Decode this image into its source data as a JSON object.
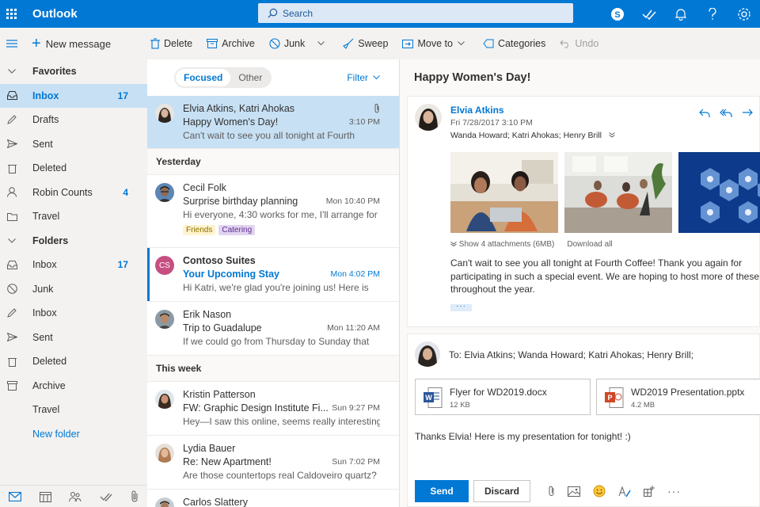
{
  "app": {
    "title": "Outlook"
  },
  "search": {
    "placeholder": "Search"
  },
  "toolbar": {
    "new_message": "New message",
    "delete": "Delete",
    "archive": "Archive",
    "junk": "Junk",
    "sweep": "Sweep",
    "move_to": "Move to",
    "categories": "Categories",
    "undo": "Undo"
  },
  "sidebar": {
    "favorites": "Favorites",
    "folders": "Folders",
    "new_folder": "New folder",
    "favorites_items": [
      {
        "label": "Inbox",
        "count": "17",
        "icon": "inbox-icon"
      },
      {
        "label": "Drafts",
        "count": "",
        "icon": "pencil-icon"
      },
      {
        "label": "Sent",
        "count": "",
        "icon": "send-icon"
      },
      {
        "label": "Deleted",
        "count": "",
        "icon": "trash-icon"
      },
      {
        "label": "Robin Counts",
        "count": "4",
        "icon": "person-icon"
      },
      {
        "label": "Travel",
        "count": "",
        "icon": "folder-icon"
      }
    ],
    "folder_items": [
      {
        "label": "Inbox",
        "count": "17",
        "icon": "inbox-icon"
      },
      {
        "label": "Junk",
        "count": "",
        "icon": "block-icon"
      },
      {
        "label": "Inbox",
        "count": "",
        "icon": "pencil-icon"
      },
      {
        "label": "Sent",
        "count": "",
        "icon": "send-icon"
      },
      {
        "label": "Deleted",
        "count": "",
        "icon": "trash-icon"
      },
      {
        "label": "Archive",
        "count": "",
        "icon": "archive-icon"
      },
      {
        "label": "Travel",
        "count": "",
        "icon": ""
      }
    ]
  },
  "list": {
    "tab_focused": "Focused",
    "tab_other": "Other",
    "filter": "Filter",
    "section_yesterday": "Yesterday",
    "section_week": "This week",
    "messages": [
      {
        "sender": "Elvia Atkins, Katri Ahokas",
        "subject": "Happy Women's Day!",
        "time": "3:10 PM",
        "preview": "Can't wait to see you all tonight at Fourth"
      },
      {
        "sender": "Cecil Folk",
        "subject": "Surprise birthday planning",
        "time": "Mon 10:40 PM",
        "preview": "Hi everyone, 4:30 works for me, I'll arrange for",
        "tags": [
          "Friends",
          "Catering"
        ]
      },
      {
        "sender": "Contoso Suites",
        "initials": "CS",
        "subject": "Your Upcoming Stay",
        "time": "Mon 4:02 PM",
        "preview": "Hi Katri, we're glad you're joining us! Here is"
      },
      {
        "sender": "Erik Nason",
        "subject": "Trip to Guadalupe",
        "time": "Mon 11:20 AM",
        "preview": "If we could go from Thursday to Sunday that"
      },
      {
        "sender": "Kristin Patterson",
        "subject": "FW: Graphic Design Institute Fi...",
        "time": "Sun 9:27 PM",
        "preview": "Hey—I saw this online, seems really interesting."
      },
      {
        "sender": "Lydia Bauer",
        "subject": "Re: New Apartment!",
        "time": "Sun 7:02 PM",
        "preview": "Are those countertops real Caldoveiro quartz?"
      },
      {
        "sender": "Carlos Slattery",
        "subject": "",
        "time": "",
        "preview": ""
      }
    ]
  },
  "reading": {
    "subject": "Happy Women's Day!",
    "from": "Elvia Atkins",
    "date": "Fri 7/28/2017 3:10 PM",
    "to": "Wanda Howard; Katri Ahokas; Henry Brill",
    "show_attachments": "Show 4 attachments (6MB)",
    "download_all": "Download all",
    "body": "Can't wait to see you all tonight at Fourth Coffee! Thank you again for participating in such a special event. We are hoping to host more of these throughout the year.",
    "more": "···"
  },
  "reply": {
    "to": "To: Elvia Atkins; Wanda Howard; Katri Ahokas; Henry Brill;",
    "file1_name": "Flyer for WD2019.docx",
    "file1_size": "12 KB",
    "file2_name": "WD2019 Presentation.pptx",
    "file2_size": "4.2 MB",
    "text": "Thanks Elvia! Here is my presentation for tonight! :)",
    "send": "Send",
    "discard": "Discard",
    "more": "···"
  },
  "colors": {
    "brand": "#0078d4",
    "selected": "#c7e0f4",
    "word": "#2b579a",
    "powerpoint": "#d24726"
  }
}
